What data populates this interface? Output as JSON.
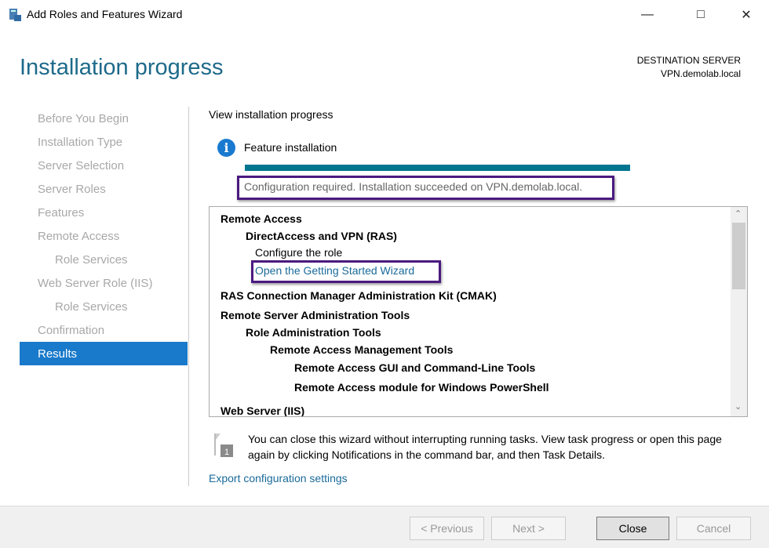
{
  "window": {
    "title": "Add Roles and Features Wizard",
    "app_icon": "server-manager-icon"
  },
  "header": {
    "page_title": "Installation progress",
    "destination_label": "DESTINATION SERVER",
    "destination_server": "VPN.demolab.local"
  },
  "sidebar": {
    "items": [
      {
        "label": "Before You Begin",
        "sub": false
      },
      {
        "label": "Installation Type",
        "sub": false
      },
      {
        "label": "Server Selection",
        "sub": false
      },
      {
        "label": "Server Roles",
        "sub": false
      },
      {
        "label": "Features",
        "sub": false
      },
      {
        "label": "Remote Access",
        "sub": false
      },
      {
        "label": "Role Services",
        "sub": true
      },
      {
        "label": "Web Server Role (IIS)",
        "sub": false
      },
      {
        "label": "Role Services",
        "sub": true
      },
      {
        "label": "Confirmation",
        "sub": false
      },
      {
        "label": "Results",
        "sub": false,
        "selected": true
      }
    ]
  },
  "main": {
    "view_label": "View installation progress",
    "feature_label": "Feature installation",
    "progress_percent": 100,
    "status": "Configuration required. Installation succeeded on VPN.demolab.local.",
    "results": [
      {
        "text": "Remote Access",
        "bold": true,
        "indent": 0
      },
      {
        "text": "DirectAccess and VPN (RAS)",
        "bold": true,
        "indent": 1
      },
      {
        "text": "Configure the role",
        "bold": false,
        "indent": 2
      },
      {
        "text": "Open the Getting Started Wizard",
        "link": true,
        "indent": 2
      },
      {
        "text": "RAS Connection Manager Administration Kit (CMAK)",
        "bold": true,
        "indent": 0
      },
      {
        "text": "Remote Server Administration Tools",
        "bold": true,
        "indent": 0
      },
      {
        "text": "Role Administration Tools",
        "bold": true,
        "indent": 1
      },
      {
        "text": "Remote Access Management Tools",
        "bold": true,
        "indent": 3
      },
      {
        "text": "Remote Access GUI and Command-Line Tools",
        "bold": true,
        "indent": 4
      },
      {
        "text": "Remote Access module for Windows PowerShell",
        "bold": true,
        "indent": 4
      },
      {
        "text": "Web Server (IIS)",
        "bold": true,
        "indent": 0
      }
    ],
    "note": "You can close this wizard without interrupting running tasks. View task progress or open this page again by clicking Notifications in the command bar, and then Task Details.",
    "note_badge": "1",
    "export_link": "Export configuration settings"
  },
  "footer": {
    "previous": "< Previous",
    "next": "Next >",
    "close": "Close",
    "cancel": "Cancel"
  },
  "colors": {
    "accent": "#1979ca",
    "progress": "#007590",
    "highlight_box": "#4b1a7f",
    "link": "#1a6a9a"
  }
}
